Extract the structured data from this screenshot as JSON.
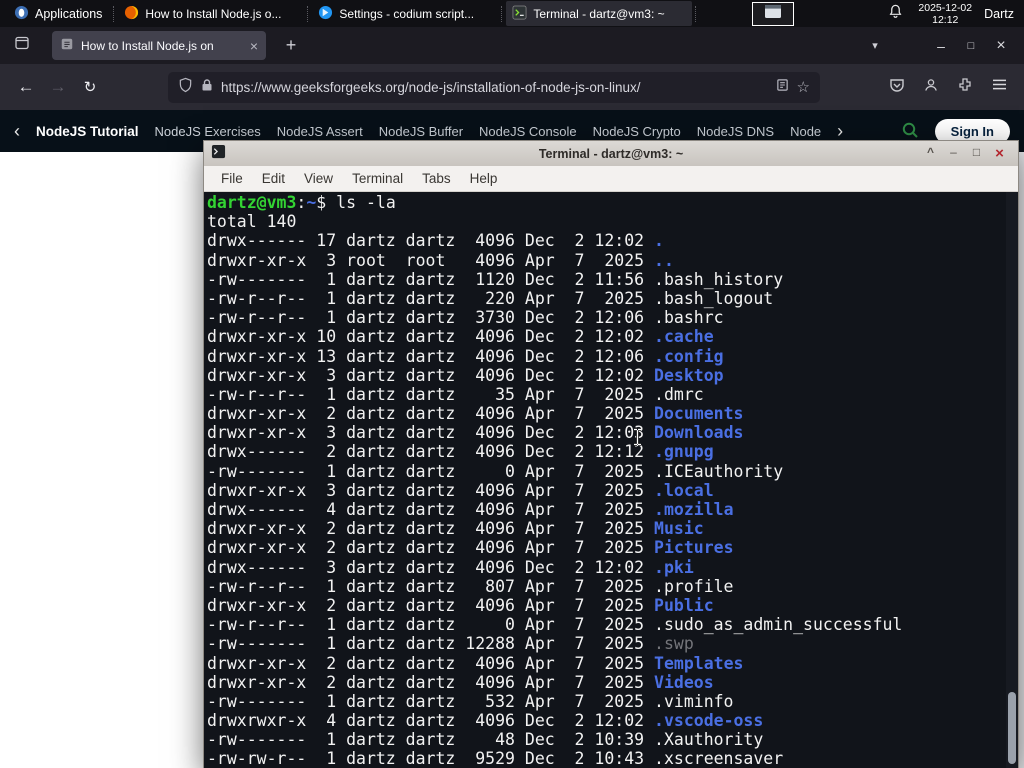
{
  "panel": {
    "applications_label": "Applications",
    "tasks": [
      {
        "title": "How to Install Node.js o...",
        "app": "firefox"
      },
      {
        "title": "Settings - codium script...",
        "app": "codium"
      },
      {
        "title": "Terminal - dartz@vm3: ~",
        "app": "terminal"
      }
    ],
    "clock": {
      "date": "2025-12-02",
      "time": "12:12"
    },
    "user_label": "Dartz"
  },
  "browser": {
    "tab": {
      "title": "How to Install Node.js on",
      "close_glyph": "×"
    },
    "new_tab_glyph": "+",
    "alltabs_glyph": "▾",
    "window_controls": {
      "minimize": "–",
      "maximize": "□",
      "close": "×"
    },
    "nav": {
      "back": "←",
      "forward": "→",
      "reload": "↻"
    },
    "urlbar": {
      "url": "https://www.geeksforgeeks.org/node-js/installation-of-node-js-on-linux/",
      "star_glyph": "☆"
    },
    "gfg": {
      "chevron_left": "‹",
      "chevron_right": "›",
      "items": [
        "NodeJS Tutorial",
        "NodeJS Exercises",
        "NodeJS Assert",
        "NodeJS Buffer",
        "NodeJS Console",
        "NodeJS Crypto",
        "NodeJS DNS",
        "Node"
      ],
      "sign_in": "Sign In"
    }
  },
  "terminal_window": {
    "title": "Terminal - dartz@vm3: ~",
    "menu": [
      "File",
      "Edit",
      "View",
      "Terminal",
      "Tabs",
      "Help"
    ],
    "controls": {
      "shade": "^",
      "minimize": "–",
      "maximize": "□",
      "close": "×"
    },
    "lines": [
      [
        [
          "g",
          "dartz@vm3"
        ],
        [
          "f",
          ":"
        ],
        [
          "b",
          "~"
        ],
        [
          "f",
          "$ ls -la"
        ]
      ],
      [
        [
          "f",
          "total 140"
        ]
      ],
      [
        [
          "f",
          "drwx------ 17 dartz dartz  4096 Dec  2 12:02 "
        ],
        [
          "b",
          "."
        ]
      ],
      [
        [
          "f",
          "drwxr-xr-x  3 root  root   4096 Apr  7  2025 "
        ],
        [
          "b",
          ".."
        ]
      ],
      [
        [
          "f",
          "-rw-------  1 dartz dartz  1120 Dec  2 11:56 .bash_history"
        ]
      ],
      [
        [
          "f",
          "-rw-r--r--  1 dartz dartz   220 Apr  7  2025 .bash_logout"
        ]
      ],
      [
        [
          "f",
          "-rw-r--r--  1 dartz dartz  3730 Dec  2 12:06 .bashrc"
        ]
      ],
      [
        [
          "f",
          "drwxr-xr-x 10 dartz dartz  4096 Dec  2 12:02 "
        ],
        [
          "b",
          ".cache"
        ]
      ],
      [
        [
          "f",
          "drwxr-xr-x 13 dartz dartz  4096 Dec  2 12:06 "
        ],
        [
          "b",
          ".config"
        ]
      ],
      [
        [
          "f",
          "drwxr-xr-x  3 dartz dartz  4096 Dec  2 12:02 "
        ],
        [
          "b",
          "Desktop"
        ]
      ],
      [
        [
          "f",
          "-rw-r--r--  1 dartz dartz    35 Apr  7  2025 .dmrc"
        ]
      ],
      [
        [
          "f",
          "drwxr-xr-x  2 dartz dartz  4096 Apr  7  2025 "
        ],
        [
          "b",
          "Documents"
        ]
      ],
      [
        [
          "f",
          "drwxr-xr-x  3 dartz dartz  4096 Dec  2 12:03 "
        ],
        [
          "b",
          "Downloads"
        ]
      ],
      [
        [
          "f",
          "drwx------  2 dartz dartz  4096 Dec  2 12:12 "
        ],
        [
          "b",
          ".gnupg"
        ]
      ],
      [
        [
          "f",
          "-rw-------  1 dartz dartz     0 Apr  7  2025 .ICEauthority"
        ]
      ],
      [
        [
          "f",
          "drwxr-xr-x  3 dartz dartz  4096 Apr  7  2025 "
        ],
        [
          "b",
          ".local"
        ]
      ],
      [
        [
          "f",
          "drwx------  4 dartz dartz  4096 Apr  7  2025 "
        ],
        [
          "b",
          ".mozilla"
        ]
      ],
      [
        [
          "f",
          "drwxr-xr-x  2 dartz dartz  4096 Apr  7  2025 "
        ],
        [
          "b",
          "Music"
        ]
      ],
      [
        [
          "f",
          "drwxr-xr-x  2 dartz dartz  4096 Apr  7  2025 "
        ],
        [
          "b",
          "Pictures"
        ]
      ],
      [
        [
          "f",
          "drwx------  3 dartz dartz  4096 Dec  2 12:02 "
        ],
        [
          "b",
          ".pki"
        ]
      ],
      [
        [
          "f",
          "-rw-r--r--  1 dartz dartz   807 Apr  7  2025 .profile"
        ]
      ],
      [
        [
          "f",
          "drwxr-xr-x  2 dartz dartz  4096 Apr  7  2025 "
        ],
        [
          "b",
          "Public"
        ]
      ],
      [
        [
          "f",
          "-rw-r--r--  1 dartz dartz     0 Apr  7  2025 .sudo_as_admin_successful"
        ]
      ],
      [
        [
          "f",
          "-rw-------  1 dartz dartz 12288 Apr  7  2025 "
        ],
        [
          "d",
          ".swp"
        ]
      ],
      [
        [
          "f",
          "drwxr-xr-x  2 dartz dartz  4096 Apr  7  2025 "
        ],
        [
          "b",
          "Templates"
        ]
      ],
      [
        [
          "f",
          "drwxr-xr-x  2 dartz dartz  4096 Apr  7  2025 "
        ],
        [
          "b",
          "Videos"
        ]
      ],
      [
        [
          "f",
          "-rw-------  1 dartz dartz   532 Apr  7  2025 .viminfo"
        ]
      ],
      [
        [
          "f",
          "drwxrwxr-x  4 dartz dartz  4096 Dec  2 12:02 "
        ],
        [
          "b",
          ".vscode-oss"
        ]
      ],
      [
        [
          "f",
          "-rw-------  1 dartz dartz    48 Dec  2 10:39 .Xauthority"
        ]
      ],
      [
        [
          "f",
          "-rw-rw-r--  1 dartz dartz  9529 Dec  2 10:43 .xscreensaver"
        ]
      ]
    ]
  },
  "colors": {
    "term_green": "#33d433",
    "term_blue": "#4a6fe3",
    "term_fg": "#f2f2f2",
    "term_dim": "#74757a",
    "gfg_green": "#2f8d46"
  }
}
